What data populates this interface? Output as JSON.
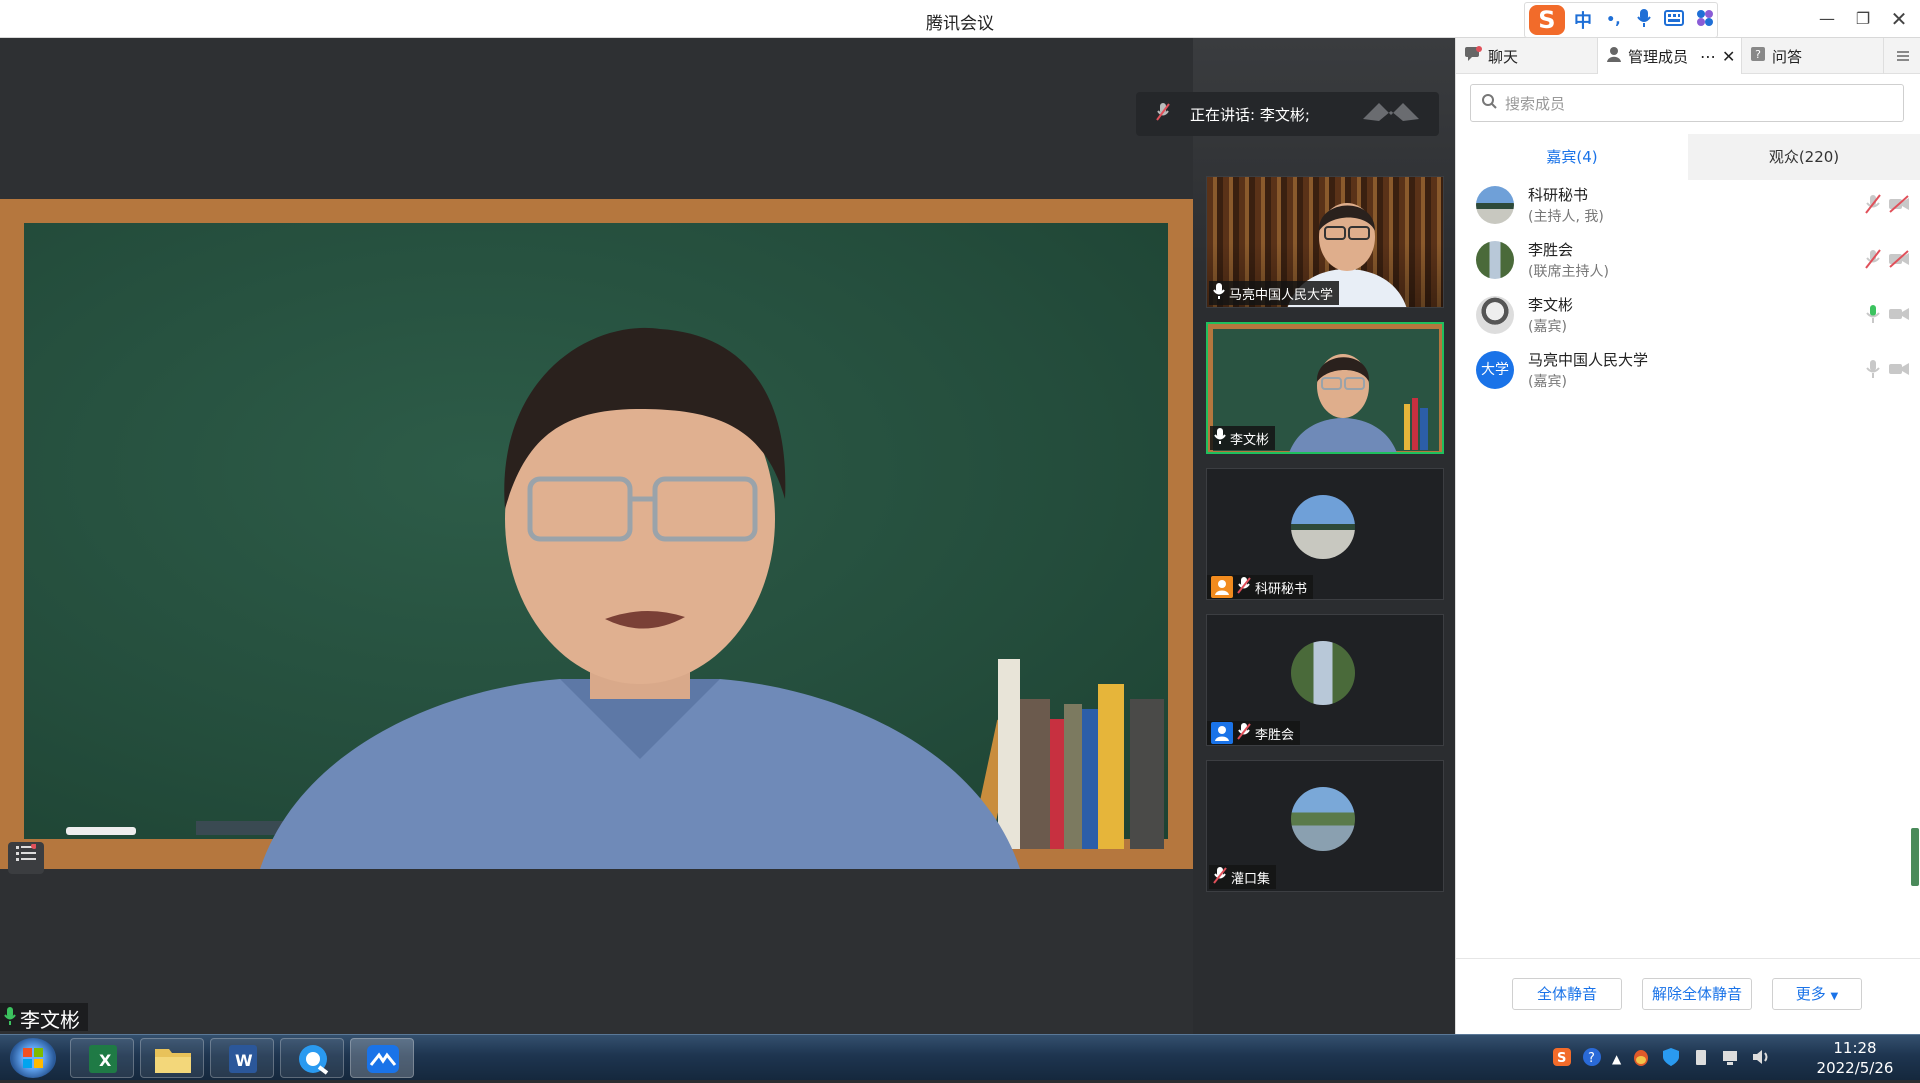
{
  "window": {
    "title": "腾讯会议"
  },
  "ime": {
    "lang": "中",
    "punct": "•,"
  },
  "stage": {
    "talking_label": "正在讲话: 李文彬;",
    "speaker_name": "李文彬"
  },
  "thumbs": [
    {
      "name": "马亮中国人民大学",
      "type": "video",
      "mic": "on"
    },
    {
      "name": "李文彬",
      "type": "video",
      "mic": "on",
      "active": true
    },
    {
      "name": "科研秘书",
      "type": "avatar",
      "mic": "muted",
      "badge_color": "#f28b1e"
    },
    {
      "name": "李胜会",
      "type": "avatar",
      "mic": "muted",
      "badge_color": "#1a73e8"
    },
    {
      "name": "灌口集",
      "type": "avatar",
      "mic": "muted"
    }
  ],
  "panel": {
    "tabs": [
      {
        "label": "聊天",
        "icon": "chat-icon"
      },
      {
        "label": "管理成员",
        "icon": "members-icon"
      },
      {
        "label": "问答",
        "icon": "qa-icon"
      }
    ],
    "search_placeholder": "搜索成员",
    "subtabs": {
      "guests": "嘉宾(4)",
      "audience": "观众(220)"
    },
    "members": [
      {
        "name": "科研秘书",
        "role": "(主持人, 我)",
        "mic": "muted",
        "cam": "off"
      },
      {
        "name": "李胜会",
        "role": "(联席主持人)",
        "mic": "muted",
        "cam": "off"
      },
      {
        "name": "李文彬",
        "role": "(嘉宾)",
        "mic": "on",
        "cam": "idle"
      },
      {
        "name": "马亮中国人民大学",
        "role": "(嘉宾)",
        "mic": "idle",
        "cam": "idle",
        "avatar_text": "大学"
      }
    ],
    "buttons": {
      "mute_all": "全体静音",
      "unmute_all": "解除全体静音",
      "more": "更多"
    }
  },
  "taskbar": {
    "time": "11:28",
    "date": "2022/5/26",
    "apps": [
      "start",
      "excel",
      "explorer",
      "word",
      "qq-browser",
      "tencent-meeting"
    ]
  },
  "colors": {
    "accent": "#1a73e8",
    "active_border": "#1fbf5e",
    "mic_on": "#3cc35f",
    "mic_muted": "#e0505a"
  }
}
